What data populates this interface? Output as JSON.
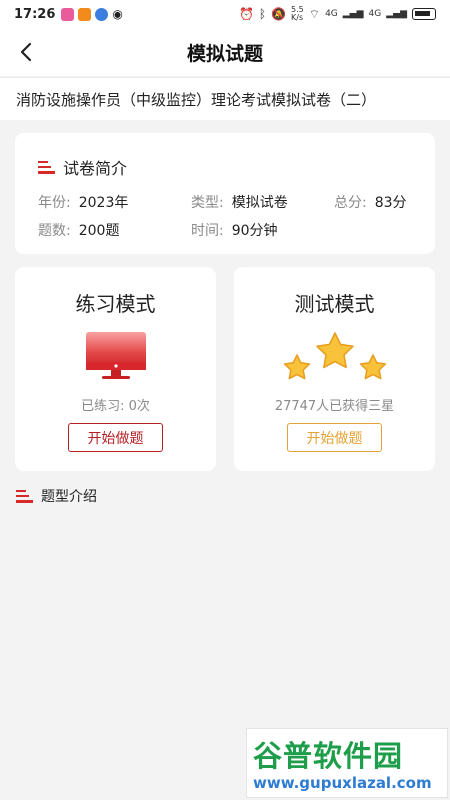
{
  "status_bar": {
    "time": "17:26",
    "net_speed": "5.5\nK/s",
    "signal1_label": "4G",
    "signal2_label": "4G"
  },
  "nav": {
    "title": "模拟试题"
  },
  "exam": {
    "title": "消防设施操作员（中级监控）理论考试模拟试卷（二）"
  },
  "intro": {
    "heading": "试卷简介",
    "year_label": "年份:",
    "year_value": "2023年",
    "type_label": "类型:",
    "type_value": "模拟试卷",
    "score_label": "总分:",
    "score_value": "83分",
    "count_label": "题数:",
    "count_value": "200题",
    "time_label": "时间:",
    "time_value": "90分钟"
  },
  "practice_mode": {
    "title": "练习模式",
    "stat": "已练习: 0次",
    "button": "开始做题"
  },
  "test_mode": {
    "title": "测试模式",
    "stat": "27747人已获得三星",
    "button": "开始做题"
  },
  "question_types": {
    "heading": "题型介绍"
  },
  "watermark": {
    "top": "谷普软件园",
    "bottom": "www.gupuxlazal.com"
  },
  "colors": {
    "accent_red": "#b52025",
    "accent_orange": "#e6a235",
    "icon_red": "#d62a2a",
    "star_yellow": "#f8c23a"
  }
}
